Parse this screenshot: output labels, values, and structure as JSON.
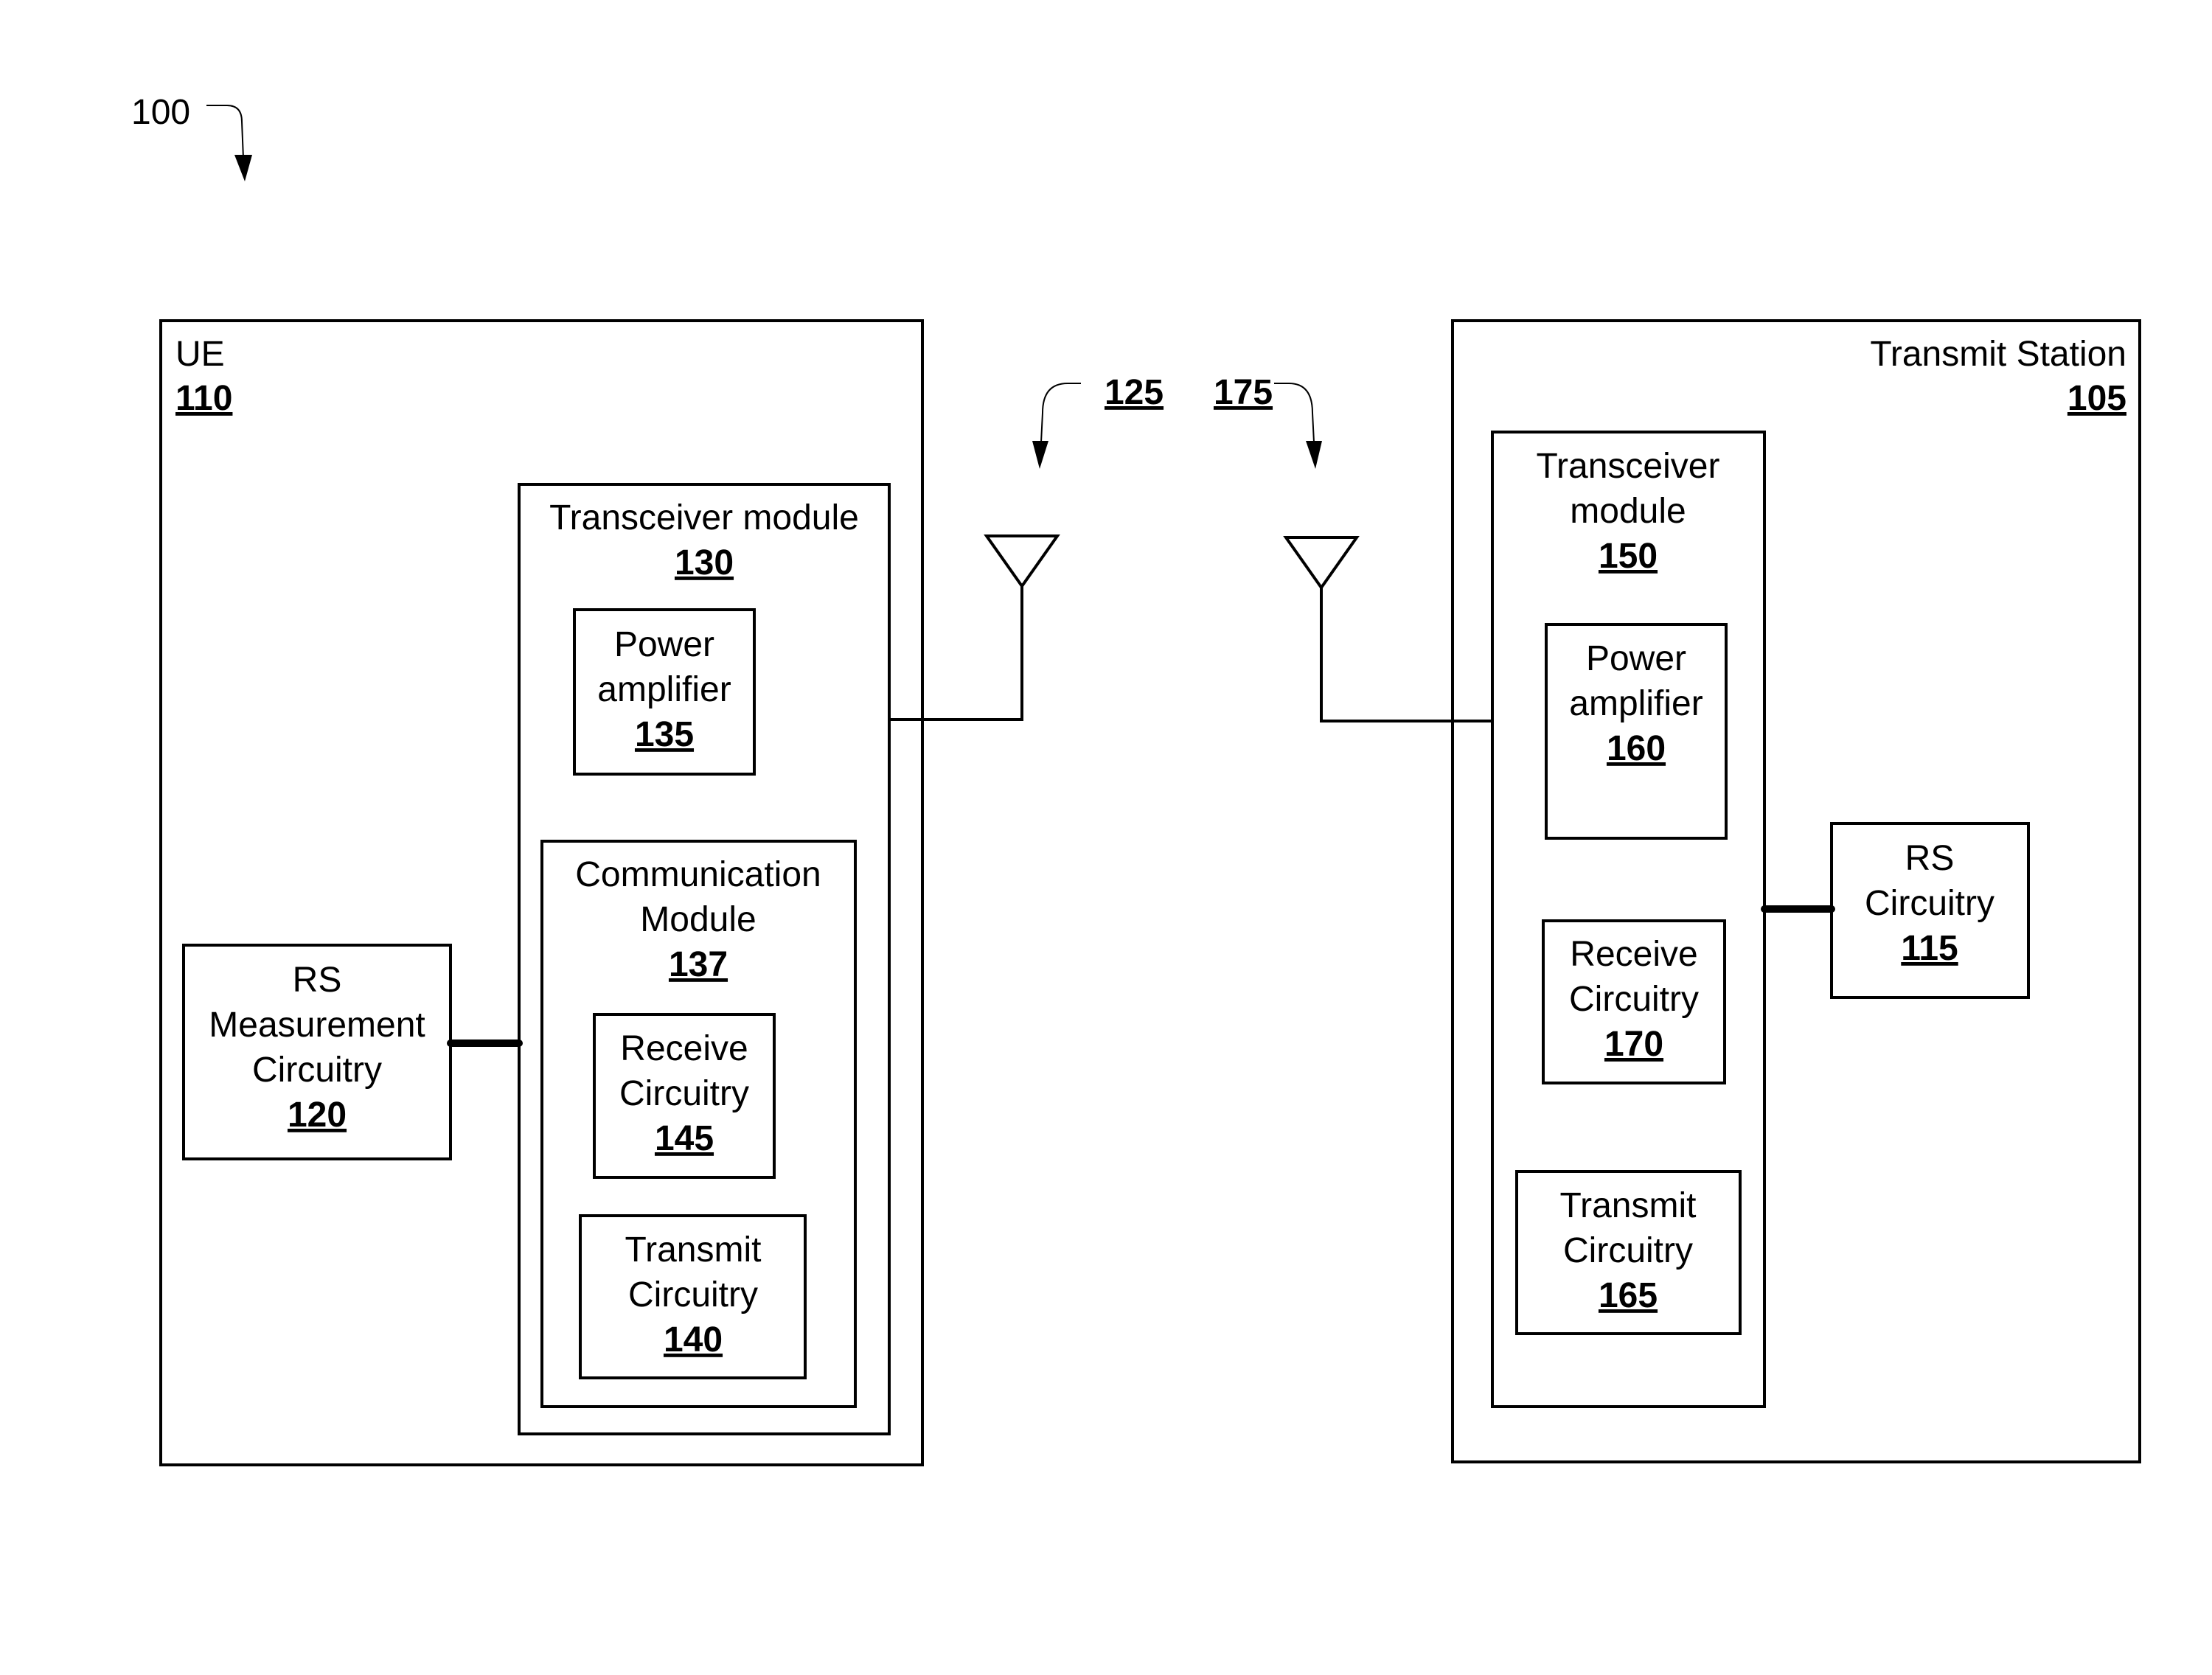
{
  "figure_label": "100",
  "ue": {
    "title": "UE",
    "ref": "110",
    "rs_measurement": {
      "lines": [
        "RS",
        "Measurement",
        "Circuitry"
      ],
      "ref": "120"
    },
    "transceiver": {
      "title": "Transceiver module",
      "ref": "130",
      "power_amplifier": {
        "lines": [
          "Power",
          "amplifier"
        ],
        "ref": "135"
      },
      "communication_module": {
        "lines": [
          "Communication",
          "Module"
        ],
        "ref": "137",
        "receive_circuitry": {
          "lines": [
            "Receive",
            "Circuitry"
          ],
          "ref": "145"
        },
        "transmit_circuitry": {
          "lines": [
            "Transmit",
            "Circuitry"
          ],
          "ref": "140"
        }
      }
    },
    "antenna_ref": "125"
  },
  "transmit_station": {
    "title": "Transmit Station",
    "ref": "105",
    "transceiver": {
      "lines": [
        "Transceiver",
        "module"
      ],
      "ref": "150",
      "power_amplifier": {
        "lines": [
          "Power",
          "amplifier"
        ],
        "ref": "160"
      },
      "receive_circuitry": {
        "lines": [
          "Receive",
          "Circuitry"
        ],
        "ref": "170"
      },
      "transmit_circuitry": {
        "lines": [
          "Transmit",
          "Circuitry"
        ],
        "ref": "165"
      }
    },
    "rs_circuitry": {
      "lines": [
        "RS",
        "Circuitry"
      ],
      "ref": "115"
    },
    "antenna_ref": "175"
  }
}
